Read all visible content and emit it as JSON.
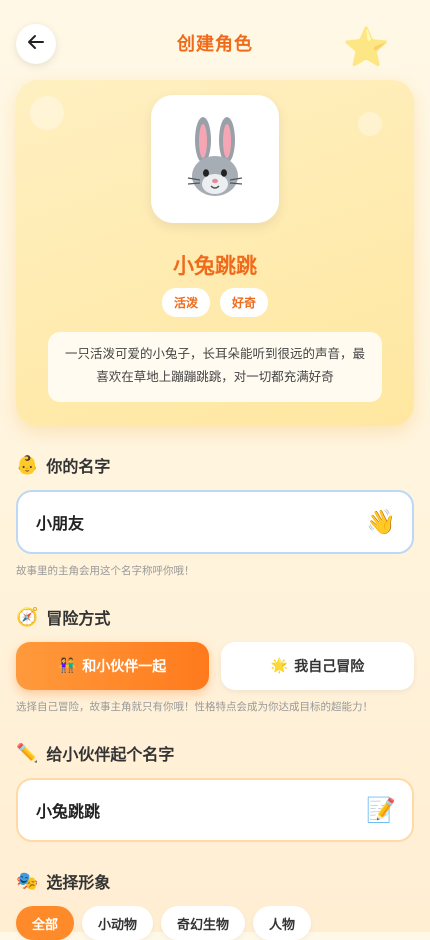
{
  "header": {
    "title": "创建角色",
    "back_icon": "arrow-left-icon",
    "decor_icon": "⭐"
  },
  "hero": {
    "avatar_emoji": "🐰",
    "name": "小兔跳跳",
    "tags": [
      "活泼",
      "好奇"
    ],
    "description": "一只活泼可爱的小兔子，长耳朵能听到很远的声音，最喜欢在草地上蹦蹦跳跳，对一切都充满好奇"
  },
  "name_section": {
    "emoji": "👶",
    "title": "你的名字",
    "value": "小朋友",
    "trailing_emoji": "👋",
    "hint": "故事里的主角会用这个名字称呼你哦！"
  },
  "mode_section": {
    "emoji": "🧭",
    "title": "冒险方式",
    "options": [
      {
        "emoji": "👫",
        "label": "和小伙伴一起",
        "selected": true
      },
      {
        "emoji": "🌟",
        "label": "我自己冒险",
        "selected": false
      }
    ],
    "hint": "选择自己冒险，故事主角就只有你哦！性格特点会成为你达成目标的超能力！"
  },
  "buddy_section": {
    "emoji": "✏️",
    "title": "给小伙伴起个名字",
    "value": "小兔跳跳",
    "trailing_emoji": "📝"
  },
  "image_section": {
    "emoji": "🎭",
    "title": "选择形象",
    "filters": [
      {
        "label": "全部",
        "selected": true
      },
      {
        "label": "小动物",
        "selected": false
      },
      {
        "label": "奇幻生物",
        "selected": false
      },
      {
        "label": "人物",
        "selected": false
      }
    ]
  },
  "colors": {
    "accent": "#ef6b1c",
    "accent_gradient_start": "#ff9a3c",
    "accent_gradient_end": "#ff7a1c",
    "background": "#fff8e6",
    "hero_card": "#ffe7a0"
  }
}
